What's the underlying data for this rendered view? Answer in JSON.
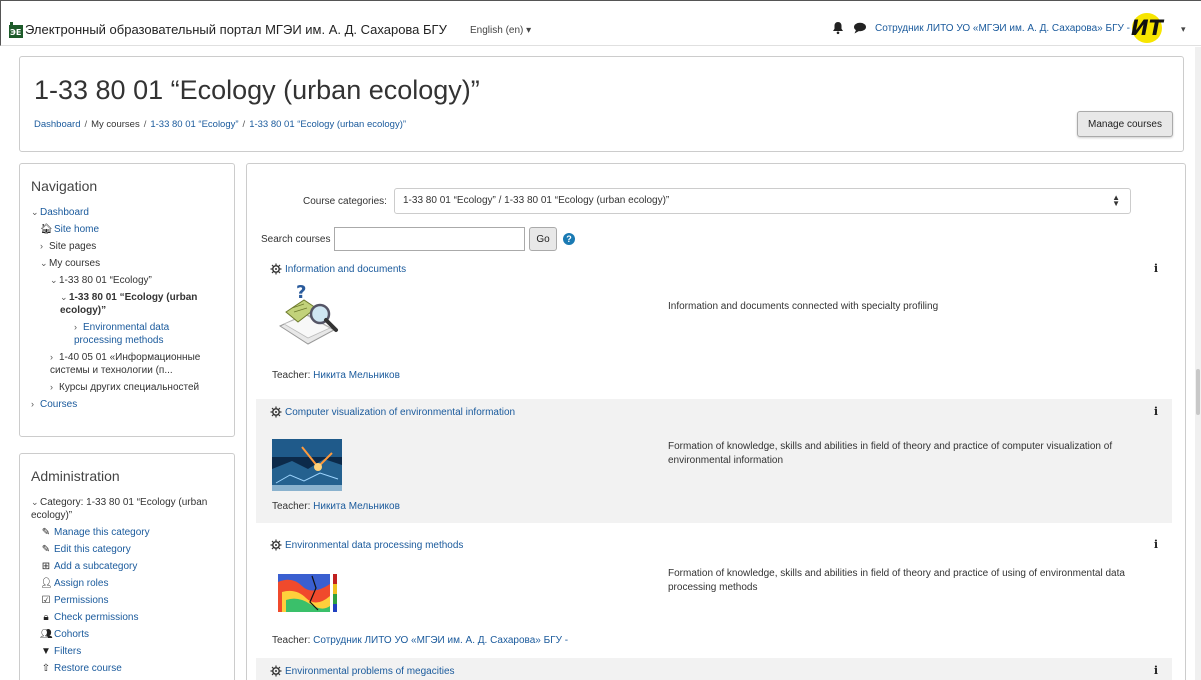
{
  "navbar": {
    "site_title": "Электронный образовательный портал МГЭИ им. А. Д. Сахарова БГУ",
    "language": "English (en) ▾",
    "user_name": "Сотрудник ЛИТО УО «МГЭИ им. А. Д. Сахарова» БГУ -",
    "avatar_text": "ИТ",
    "user_caret": "▾"
  },
  "header": {
    "title": "1-33 80 01 “Ecology (urban ecology)”",
    "breadcrumb": [
      "Dashboard",
      "My courses",
      "1-33 80 01 “Ecology”",
      "1-33 80 01 “Ecology (urban ecology)”"
    ],
    "breadcrumb_sep": "/",
    "manage_courses": "Manage courses"
  },
  "navigation": {
    "title": "Navigation",
    "dashboard": "Dashboard",
    "site_home": "Site home",
    "site_pages": "Site pages",
    "my_courses": "My courses",
    "ecology": "1-33 80 01 “Ecology”",
    "urban_ecology": "1-33 80 01 “Ecology (urban ecology)”",
    "env_data": "Environmental data processing methods",
    "info_systems": "1-40 05 01 «Информационные системы и технологии (п...",
    "other_courses": "Курсы других специальностей",
    "courses": "Courses"
  },
  "administration": {
    "title": "Administration",
    "category": "Category: 1-33 80 01 “Ecology (urban ecology)”",
    "items": [
      "Manage this category",
      "Edit this category",
      "Add a subcategory",
      "Assign roles",
      "Permissions",
      "Check permissions",
      "Cohorts",
      "Filters",
      "Restore course"
    ]
  },
  "main": {
    "categories_label": "Course categories:",
    "categories_value": "1-33 80 01 “Ecology” / 1-33 80 01 “Ecology (urban ecology)”",
    "search_label": "Search courses",
    "search_value": "",
    "go_label": "Go",
    "help_glyph": "?",
    "info_glyph": "i",
    "teacher_label": "Teacher:"
  },
  "courses": [
    {
      "name": "Information and documents",
      "summary": "Information and documents connected with specialty profiling",
      "teacher": "Никита Мельников"
    },
    {
      "name": "Computer visualization of environmental information",
      "summary": "Formation of knowledge, skills and abilities in field of theory and practice of computer visualization of environmental information",
      "teacher": "Никита Мельников"
    },
    {
      "name": "Environmental data processing methods",
      "summary": "Formation of knowledge, skills and abilities in field of theory and practice of using of environmental data processing methods",
      "teacher": "Сотрудник ЛИТО УО «МГЭИ им. А. Д. Сахарова» БГУ -"
    },
    {
      "name": "Environmental problems of megacities"
    }
  ],
  "colors": {
    "link": "#1a5a9c",
    "avatar_bg": "#f7e500",
    "shaded_row": "#f2f2f2"
  },
  "icons": [
    "bell-icon",
    "chat-icon",
    "home-icon",
    "pencil-icon",
    "plus-square-icon",
    "user-plus-icon",
    "edit-icon",
    "lock-icon",
    "users-icon",
    "filter-icon",
    "upload-icon",
    "course-icon",
    "info-icon",
    "help-icon"
  ]
}
